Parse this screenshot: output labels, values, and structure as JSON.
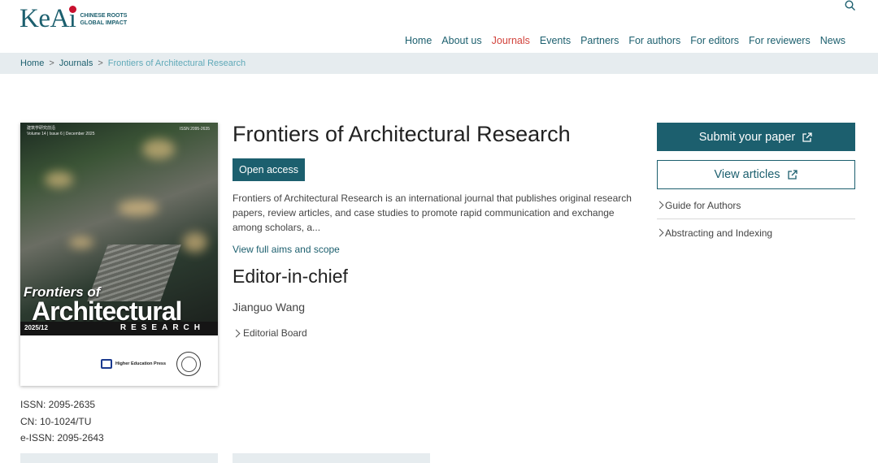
{
  "logo": {
    "word": "KeAi",
    "tagline_1": "CHINESE ROOTS",
    "tagline_2": "GLOBAL IMPACT"
  },
  "nav": {
    "items": [
      {
        "label": "Home"
      },
      {
        "label": "About us"
      },
      {
        "label": "Journals",
        "active": true
      },
      {
        "label": "Events"
      },
      {
        "label": "Partners"
      },
      {
        "label": "For authors"
      },
      {
        "label": "For editors"
      },
      {
        "label": "For reviewers"
      },
      {
        "label": "News"
      }
    ],
    "search_icon": "search-icon"
  },
  "breadcrumb": {
    "home": "Home",
    "journals": "Journals",
    "current": "Frontiers of Architectural Research",
    "separator": ">"
  },
  "cover": {
    "top_line_1": "建筑学研究前沿",
    "top_line_2": "Volume 14 | Issue 6 | December 2025",
    "issn_small": "ISSN 2095-2635",
    "title_1": "Frontiers of",
    "title_2": "Architectural",
    "research": "RESEARCH",
    "issue": "2025/12",
    "publisher": "Higher Education Press"
  },
  "meta": {
    "issn": "ISSN: 2095-2635",
    "cn": "CN: 10-1024/TU",
    "eissn": "e-ISSN: 2095-2643"
  },
  "journal": {
    "title": "Frontiers of Architectural Research",
    "open_access": "Open access",
    "description": "Frontiers of Architectural Research is an international journal that publishes original research papers, review articles, and case studies to promote rapid communication and exchange among scholars, a...",
    "aims_link": "View full aims and scope",
    "eic_heading": "Editor-in-chief",
    "eic_name": "Jianguo Wang",
    "editorial_board": "Editorial Board"
  },
  "actions": {
    "submit": "Submit your paper",
    "view": "View articles",
    "guide": "Guide for Authors",
    "abstracting": "Abstracting and Indexing"
  },
  "colors": {
    "brand": "#1c5f6e",
    "active_nav": "#d2433c",
    "breadcrumb_bg": "#e6ecef"
  }
}
